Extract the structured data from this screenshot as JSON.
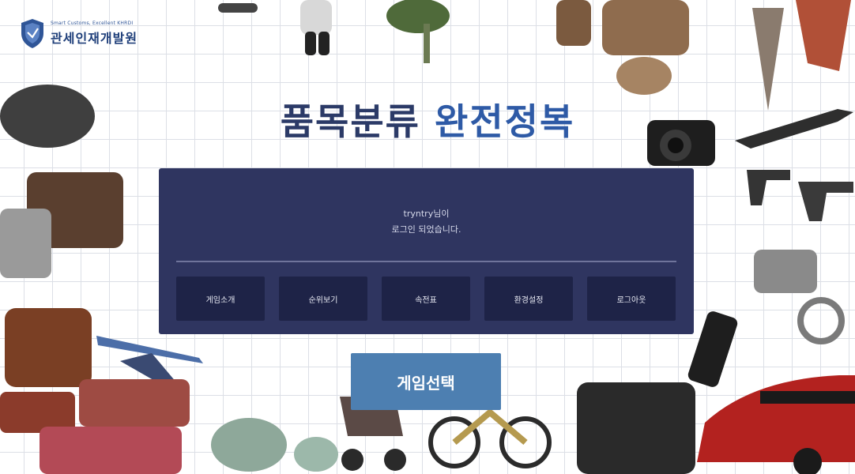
{
  "logo": {
    "slogan": "Smart Customs, Excellent KHRDI",
    "name": "관세인재개발원"
  },
  "title": {
    "part1": "품목분류",
    "part2": "완전정복"
  },
  "panel": {
    "welcome_line1": "tryntry님이",
    "welcome_line2": "로그인 되었습니다.",
    "menu": [
      {
        "label": "게임소개"
      },
      {
        "label": "순위보기"
      },
      {
        "label": "속전표"
      },
      {
        "label": "환경설정"
      },
      {
        "label": "로그아웃"
      }
    ]
  },
  "game_select_button": "게임선택",
  "colors": {
    "title_dark": "#2b3a67",
    "title_blue": "#2e5aa6",
    "panel_bg": "#2f3560",
    "menu_button_bg": "#1e2347",
    "game_button_bg": "#4d7fb1"
  },
  "icons": {
    "logo": "shield-logo-icon",
    "decor": [
      "cheese-grater",
      "plant",
      "baskets",
      "feather-objects",
      "leaves",
      "camera",
      "rifle",
      "pistols",
      "handbags",
      "airplane",
      "teapot-set",
      "stroller",
      "bicycle",
      "engine",
      "smartphone",
      "red-car",
      "fabric-rolls",
      "handcuffs"
    ]
  }
}
